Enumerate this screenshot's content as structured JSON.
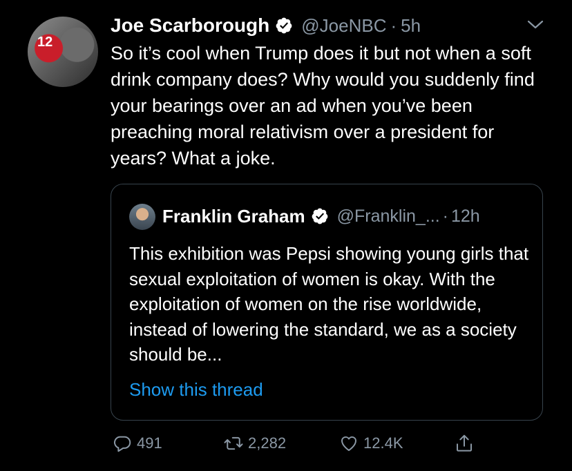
{
  "tweet": {
    "author_name": "Joe Scarborough",
    "handle": "@JoeNBC",
    "separator": "·",
    "time": "5h",
    "text": "So it’s cool when Trump does it but not when a soft drink company does? Why would you suddenly find your bearings over an ad when you’ve been preaching moral relativism over a president for years? What a joke.",
    "avatar_number": "12"
  },
  "quote": {
    "author_name": "Franklin Graham",
    "handle": "@Franklin_...",
    "separator": "·",
    "time": "12h",
    "text": "This exhibition was Pepsi showing young girls that sexual exploitation of women is okay. With the exploitation of women on the rise worldwide, instead of lowering the standard, we as a society should be...",
    "show_thread_label": "Show this thread"
  },
  "actions": {
    "replies": "491",
    "retweets": "2,282",
    "likes": "12.4K"
  },
  "colors": {
    "background": "#000000",
    "text_primary": "#ffffff",
    "text_secondary": "#8b98a5",
    "link": "#1d9bf0",
    "border": "#38444d"
  },
  "icons": [
    "verified-badge-icon",
    "chevron-down-icon",
    "reply-icon",
    "retweet-icon",
    "like-icon",
    "share-icon"
  ]
}
